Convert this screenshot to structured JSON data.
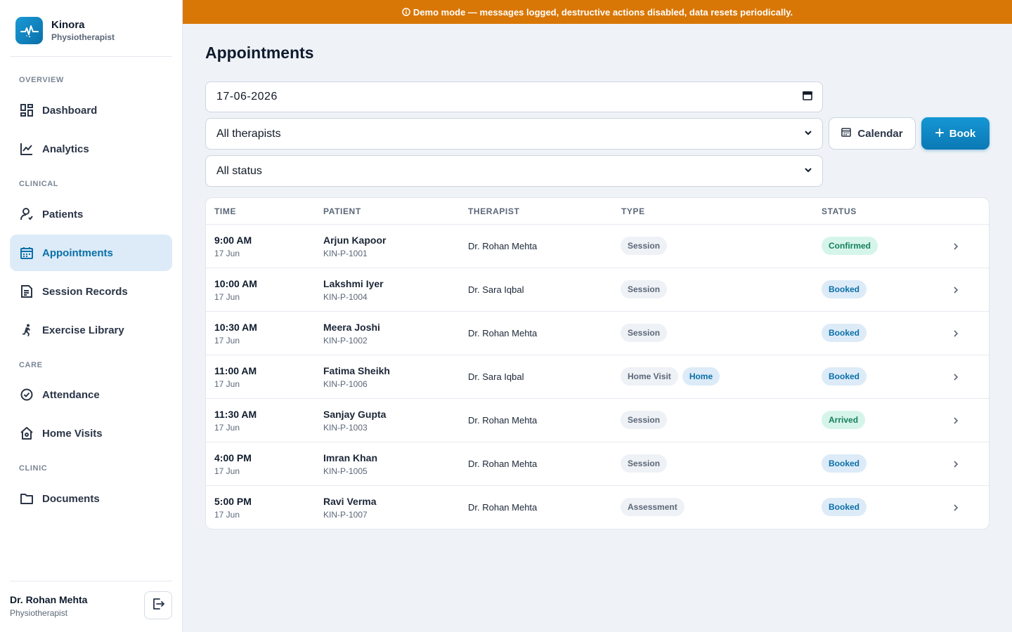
{
  "banner": {
    "text": "Demo mode — messages logged, destructive actions disabled, data resets periodically."
  },
  "brand": {
    "name": "Kinora",
    "role": "Physiotherapist"
  },
  "sidebar": {
    "sections": [
      {
        "label": "OVERVIEW"
      },
      {
        "label": "CLINICAL"
      },
      {
        "label": "CARE"
      },
      {
        "label": "CLINIC"
      }
    ],
    "items": [
      {
        "label": "Dashboard",
        "icon": "dashboard-icon"
      },
      {
        "label": "Analytics",
        "icon": "analytics-icon"
      },
      {
        "label": "Patients",
        "icon": "patients-icon"
      },
      {
        "label": "Appointments",
        "icon": "calendar-icon",
        "active": true
      },
      {
        "label": "Session Records",
        "icon": "document-icon"
      },
      {
        "label": "Exercise Library",
        "icon": "running-icon"
      },
      {
        "label": "Attendance",
        "icon": "check-circle-icon"
      },
      {
        "label": "Home Visits",
        "icon": "home-icon"
      },
      {
        "label": "Documents",
        "icon": "folder-icon"
      }
    ]
  },
  "user": {
    "name": "Dr. Rohan Mehta",
    "role": "Physiotherapist"
  },
  "main": {
    "title": "Appointments",
    "filters": {
      "date": "17-06-2026",
      "therapist": "All therapists",
      "status": "All status"
    },
    "buttons": {
      "calendar": "Calendar",
      "book": "Book"
    },
    "table": {
      "headers": [
        "TIME",
        "PATIENT",
        "THERAPIST",
        "TYPE",
        "STATUS"
      ],
      "rows": [
        {
          "time": "9:00 AM",
          "date": "17 Jun",
          "patient": "Arjun Kapoor",
          "pid": "KIN-P-1001",
          "therapist": "Dr. Rohan Mehta",
          "type": "Session",
          "tag": "",
          "status": "Confirmed"
        },
        {
          "time": "10:00 AM",
          "date": "17 Jun",
          "patient": "Lakshmi Iyer",
          "pid": "KIN-P-1004",
          "therapist": "Dr. Sara Iqbal",
          "type": "Session",
          "tag": "",
          "status": "Booked"
        },
        {
          "time": "10:30 AM",
          "date": "17 Jun",
          "patient": "Meera Joshi",
          "pid": "KIN-P-1002",
          "therapist": "Dr. Rohan Mehta",
          "type": "Session",
          "tag": "",
          "status": "Booked"
        },
        {
          "time": "11:00 AM",
          "date": "17 Jun",
          "patient": "Fatima Sheikh",
          "pid": "KIN-P-1006",
          "therapist": "Dr. Sara Iqbal",
          "type": "Home Visit",
          "tag": "Home",
          "status": "Booked"
        },
        {
          "time": "11:30 AM",
          "date": "17 Jun",
          "patient": "Sanjay Gupta",
          "pid": "KIN-P-1003",
          "therapist": "Dr. Rohan Mehta",
          "type": "Session",
          "tag": "",
          "status": "Arrived"
        },
        {
          "time": "4:00 PM",
          "date": "17 Jun",
          "patient": "Imran Khan",
          "pid": "KIN-P-1005",
          "therapist": "Dr. Rohan Mehta",
          "type": "Session",
          "tag": "",
          "status": "Booked"
        },
        {
          "time": "5:00 PM",
          "date": "17 Jun",
          "patient": "Ravi Verma",
          "pid": "KIN-P-1007",
          "therapist": "Dr. Rohan Mehta",
          "type": "Assessment",
          "tag": "",
          "status": "Booked"
        }
      ]
    }
  },
  "colors": {
    "accent": "#0b78b4",
    "banner": "#d97706",
    "confirmed": "#14805a",
    "booked": "#0b6fa8"
  }
}
